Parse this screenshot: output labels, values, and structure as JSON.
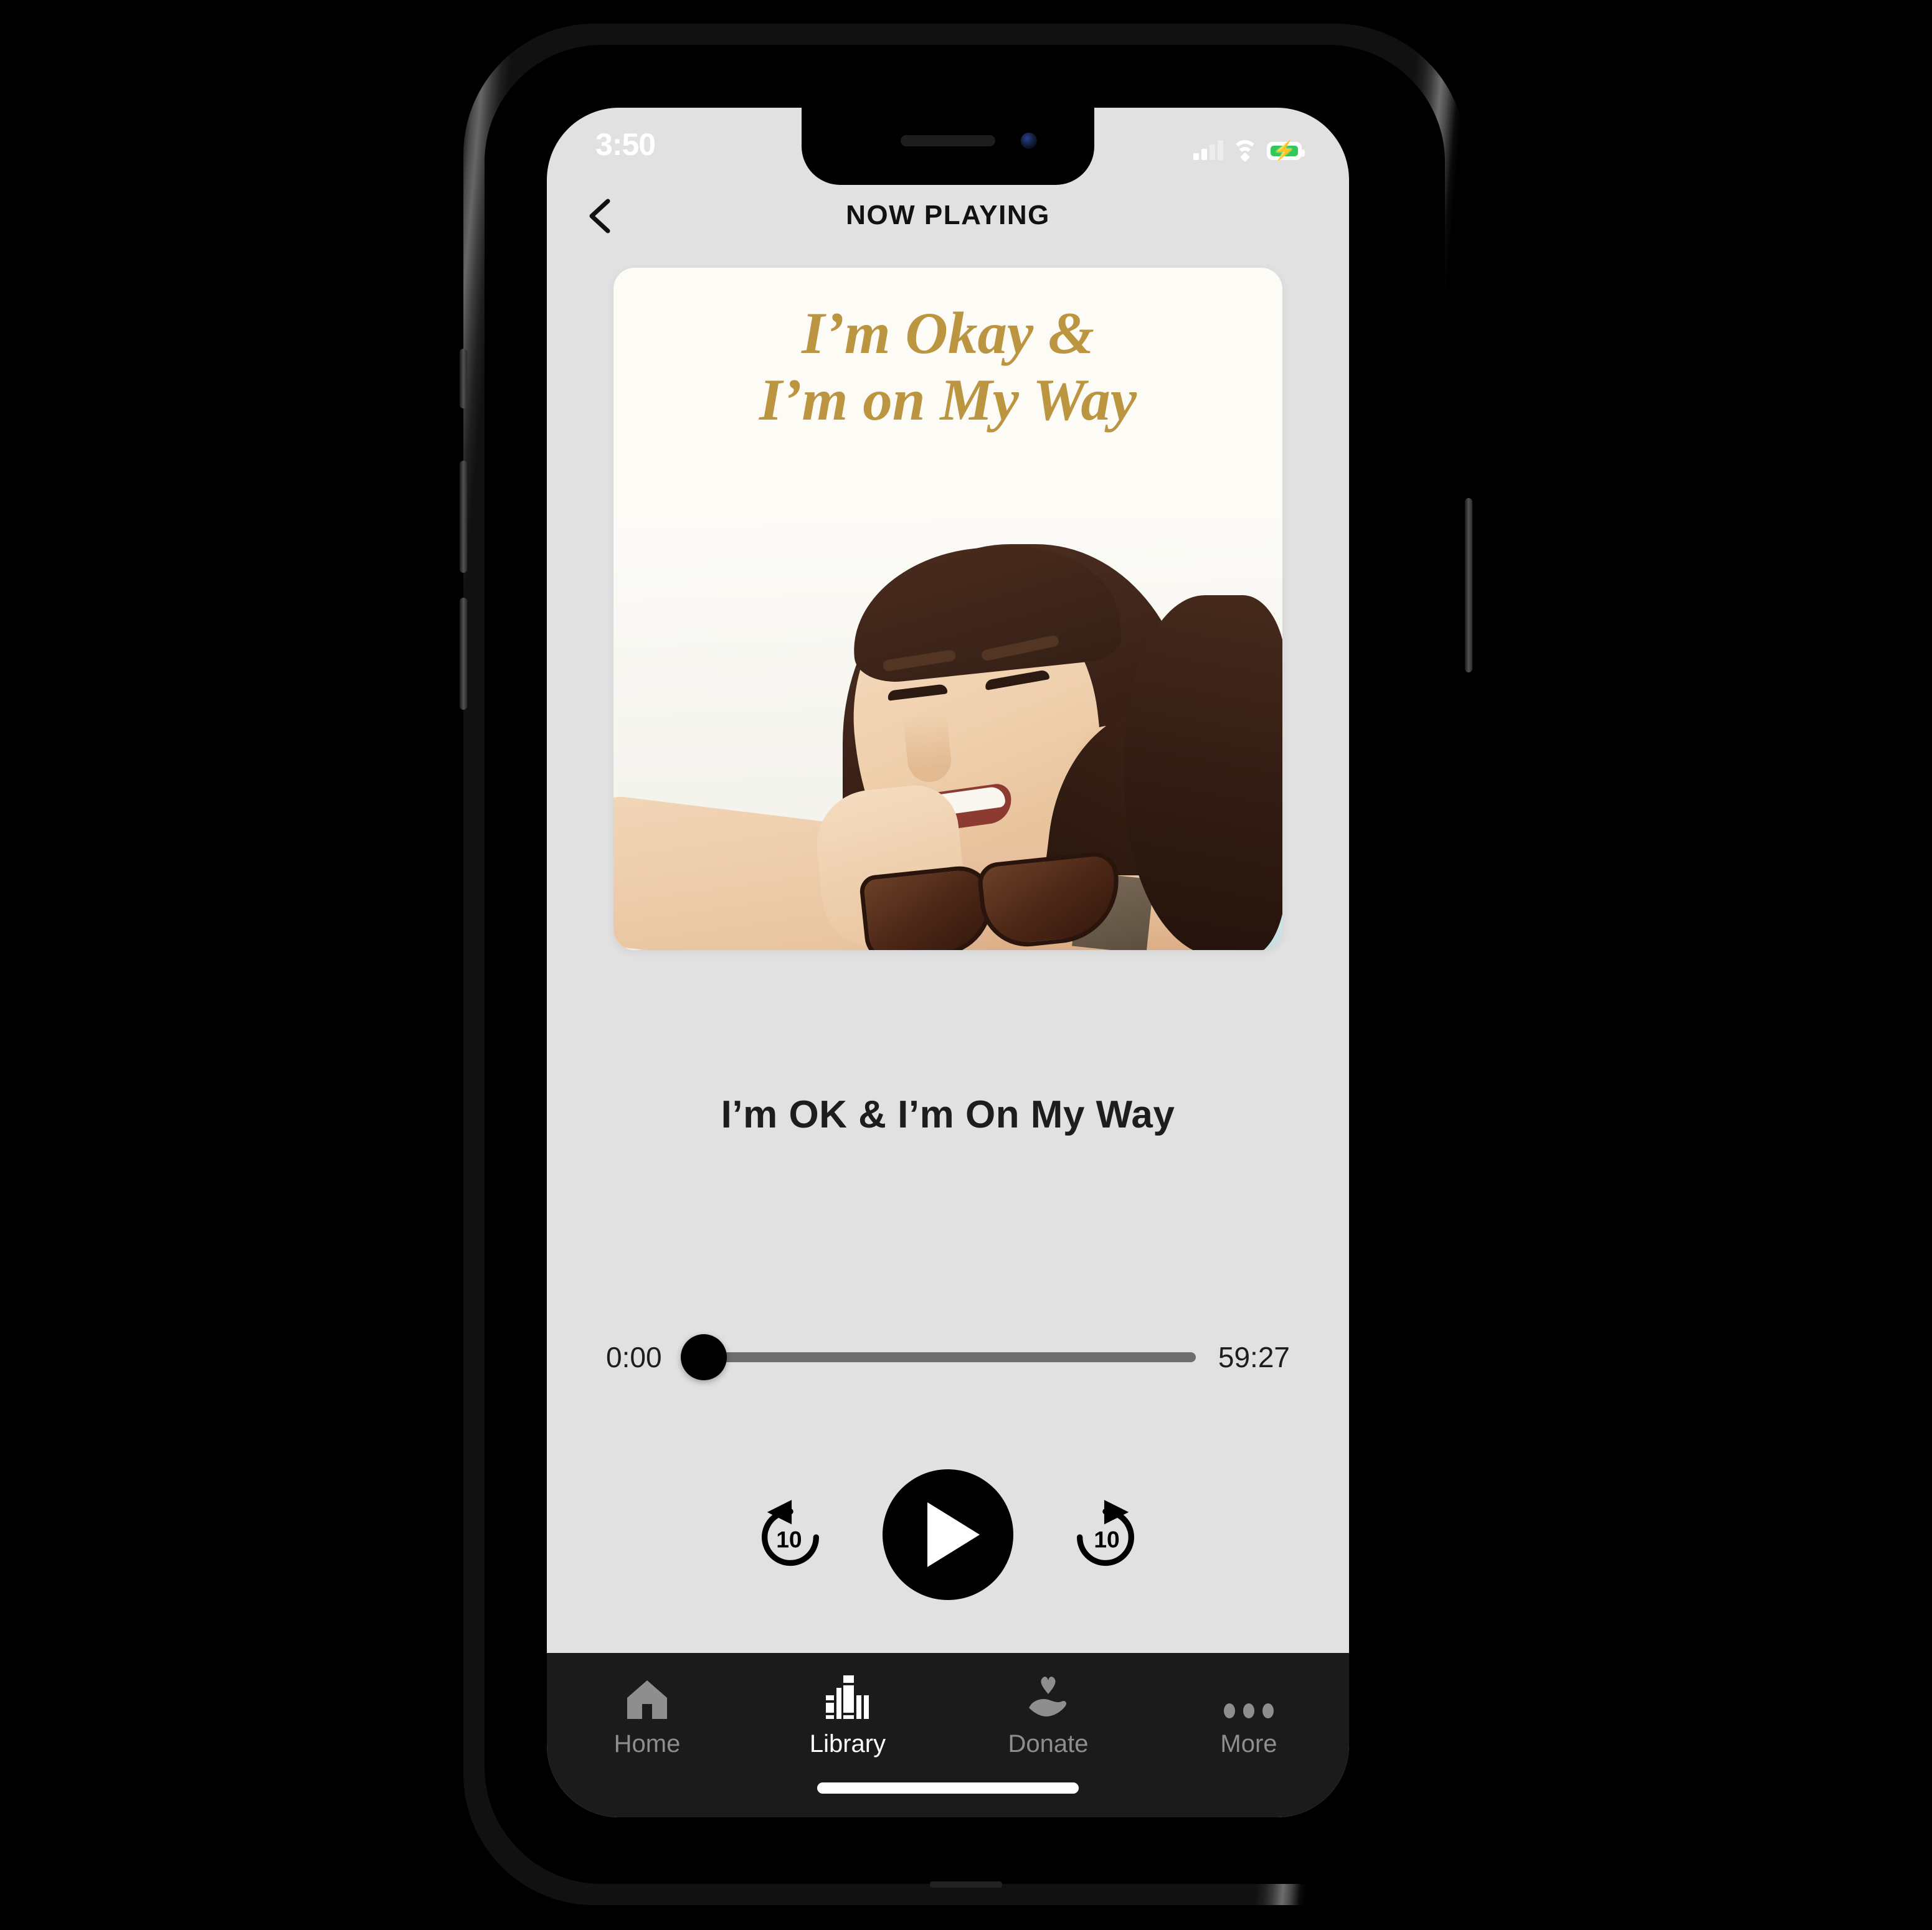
{
  "status_bar": {
    "time": "3:50",
    "signal_icon": "cellular-signal-icon",
    "wifi_icon": "wifi-icon",
    "battery_icon": "battery-charging-icon",
    "battery_color": "#34C759"
  },
  "header": {
    "back_icon": "back-chevron-icon",
    "title": "NOW PLAYING"
  },
  "artwork": {
    "title_line_1": "I’m Okay &",
    "title_line_2": "I’m on My Way",
    "title_color": "#BC9541",
    "card_background": "#FDFBF6",
    "photo_description": "smiling-woman-holding-sunglasses"
  },
  "player": {
    "track_title": "I’m OK & I’m On My Way",
    "elapsed_time": "0:00",
    "total_time": "59:27",
    "progress_percent": 0,
    "rewind_icon": "rewind-10-icon",
    "rewind_label": "10",
    "play_icon": "play-icon",
    "forward_icon": "forward-10-icon",
    "forward_label": "10"
  },
  "tab_bar": {
    "background": "#1B1B1B",
    "active_color": "#FFFFFF",
    "inactive_color": "#8E8E8E",
    "items": [
      {
        "label": "Home",
        "icon": "home-icon",
        "active": false
      },
      {
        "label": "Library",
        "icon": "library-icon",
        "active": true
      },
      {
        "label": "Donate",
        "icon": "donate-icon",
        "active": false
      },
      {
        "label": "More",
        "icon": "more-icon",
        "active": false
      }
    ]
  }
}
